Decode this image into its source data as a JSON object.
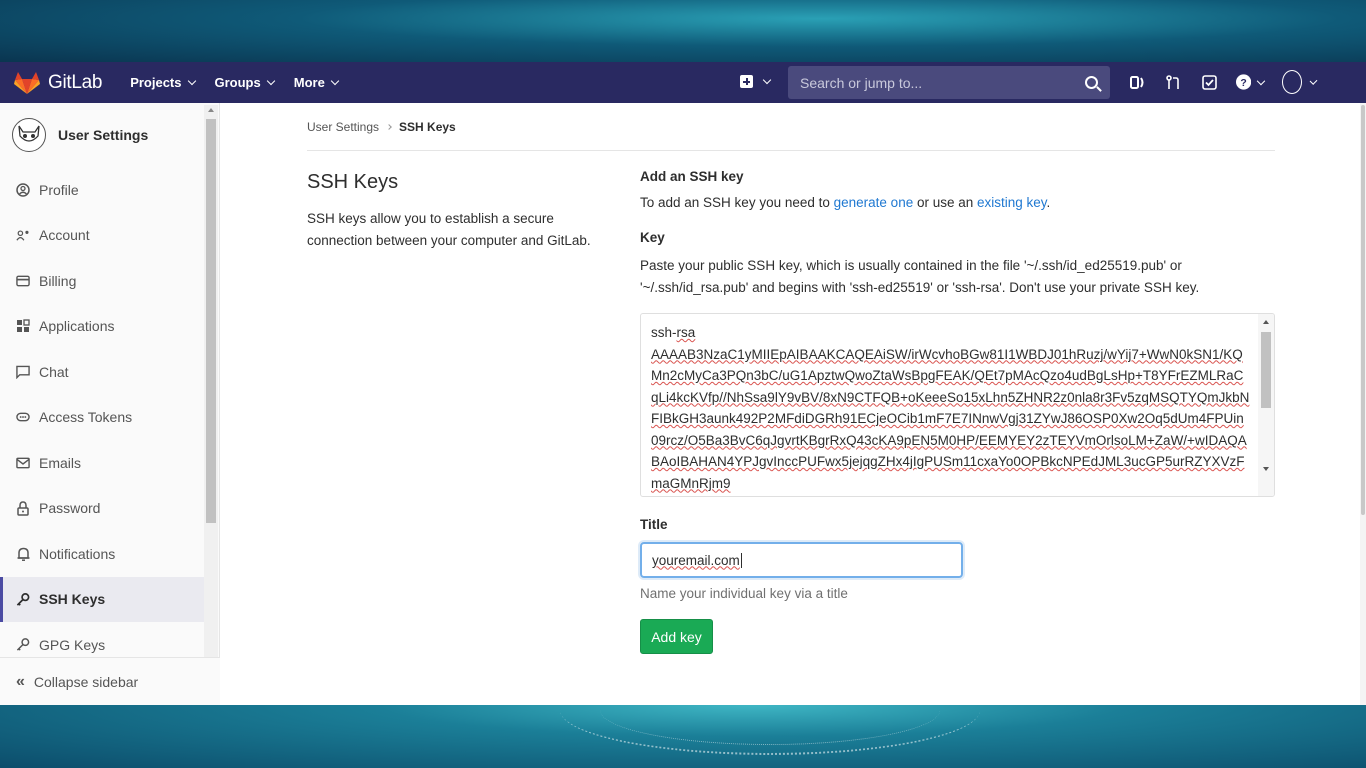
{
  "navbar": {
    "brand": "GitLab",
    "links": [
      "Projects",
      "Groups",
      "More"
    ],
    "search_placeholder": "Search or jump to..."
  },
  "sidebar": {
    "title": "User Settings",
    "items": [
      {
        "label": "Profile",
        "icon": "profile-icon"
      },
      {
        "label": "Account",
        "icon": "account-icon"
      },
      {
        "label": "Billing",
        "icon": "billing-icon"
      },
      {
        "label": "Applications",
        "icon": "applications-icon"
      },
      {
        "label": "Chat",
        "icon": "chat-icon"
      },
      {
        "label": "Access Tokens",
        "icon": "access-tokens-icon"
      },
      {
        "label": "Emails",
        "icon": "emails-icon"
      },
      {
        "label": "Password",
        "icon": "lock-icon"
      },
      {
        "label": "Notifications",
        "icon": "bell-icon"
      },
      {
        "label": "SSH Keys",
        "icon": "key-icon",
        "active": true
      },
      {
        "label": "GPG Keys",
        "icon": "key-icon"
      }
    ],
    "collapse_label": "Collapse sidebar"
  },
  "breadcrumb": {
    "parent": "User Settings",
    "current": "SSH Keys"
  },
  "intro": {
    "title": "SSH Keys",
    "description": "SSH keys allow you to establish a secure connection between your computer and GitLab."
  },
  "form": {
    "heading": "Add an SSH key",
    "add_prefix": "To add an SSH key you need to ",
    "generate_link": "generate one",
    "add_middle": " or use an ",
    "existing_link": "existing key",
    "add_suffix": ".",
    "key_label": "Key",
    "key_help": "Paste your public SSH key, which is usually contained in the file '~/.ssh/id_ed25519.pub' or '~/.ssh/id_rsa.pub' and begins with 'ssh-ed25519' or 'ssh-rsa'. Don't use your private SSH key.",
    "key_prefix": "ssh-",
    "key_type": "rsa",
    "key_value": "AAAAB3NzaC1yMIIEpAIBAAKCAQEAiSW/irWcvhoBGw81I1WBDJ01hRuzj/wYij7+WwN0kSN1/KQMn2cMyCa3PQn3bC/uG1ApztwQwoZtaWsBpgFEAK/QEt7pMAcQzo4udBgLsHp+T8YFrEZMLRaCqLi4kcKVfp//NhSsa9lY9vBV/8xN9CTFQB+oKeeeSo15xLhn5ZHNR2z0nla8r3Fv5zqMSQTYQmJkbNFIBkGH3aunk492P2MFdiDGRh91ECjeOCib1mF7E7INnwVgj31ZYwJ86OSP0Xw2Oq5dUm4FPUin09rcz/O5Ba3BvC6qJgvrtKBgrRxQ43cKA9pEN5M0HP/EEMYEY2zTEYVmOrlsoLM+ZaW/+wIDAQABAoIBAHAN4YPJgvInccPUFwx5jejqgZHx4jIgPUSm11cxaYo0OPBkcNPEdJML3ucGP5urRZYXVzFmaGMnRjm9",
    "title_label": "Title",
    "title_value": "youremail.com",
    "title_hint": "Name your individual key via a title",
    "submit_label": "Add key"
  },
  "colors": {
    "navbar": "#292961",
    "link": "#1f78d1",
    "button": "#1aaa55",
    "active_border": "#4b4ba3"
  }
}
